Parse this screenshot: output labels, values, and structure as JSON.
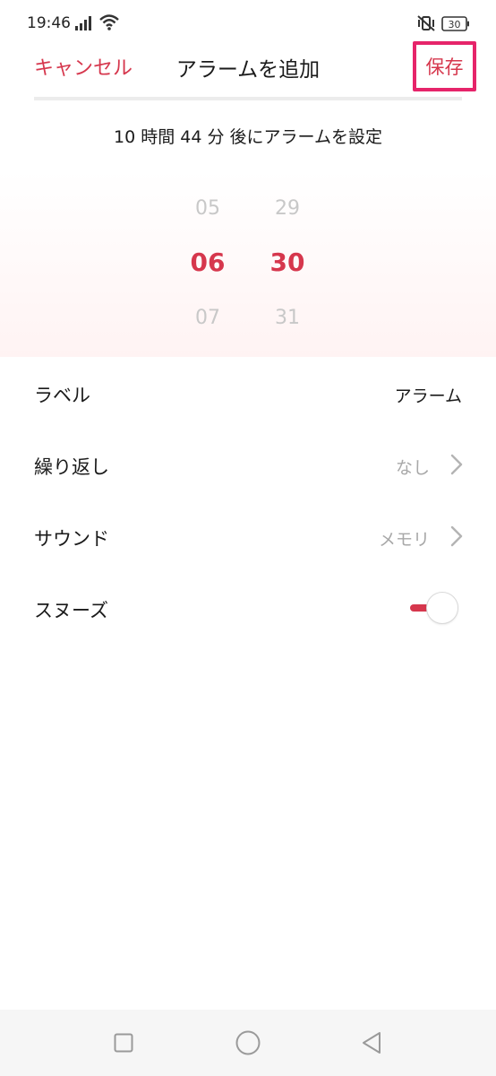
{
  "status_bar": {
    "time": "19:46",
    "battery": "30",
    "icons": [
      "signal-icon",
      "wifi-icon",
      "vibrate-off-icon",
      "battery-icon"
    ]
  },
  "header": {
    "cancel_label": "キャンセル",
    "title": "アラームを追加",
    "save_label": "保存"
  },
  "remaining_text": "10 時間 44 分 後にアラームを設定",
  "picker": {
    "hours": {
      "prev": "05",
      "selected": "06",
      "next": "07"
    },
    "minutes": {
      "prev": "29",
      "selected": "30",
      "next": "31"
    }
  },
  "settings": {
    "label": {
      "title": "ラベル",
      "value": "アラーム"
    },
    "repeat": {
      "title": "繰り返し",
      "value": "なし"
    },
    "sound": {
      "title": "サウンド",
      "value": "メモリ"
    },
    "snooze": {
      "title": "スヌーズ",
      "enabled": true
    }
  },
  "nav_bar": {
    "icons": [
      "recent-apps-icon",
      "home-icon",
      "back-icon"
    ]
  },
  "colors": {
    "accent": "#d6374d",
    "highlight_border": "#e6246a",
    "muted_text": "#a8a8a8",
    "picker_inactive": "#c8c8c8",
    "nav_background": "#f6f6f6"
  }
}
